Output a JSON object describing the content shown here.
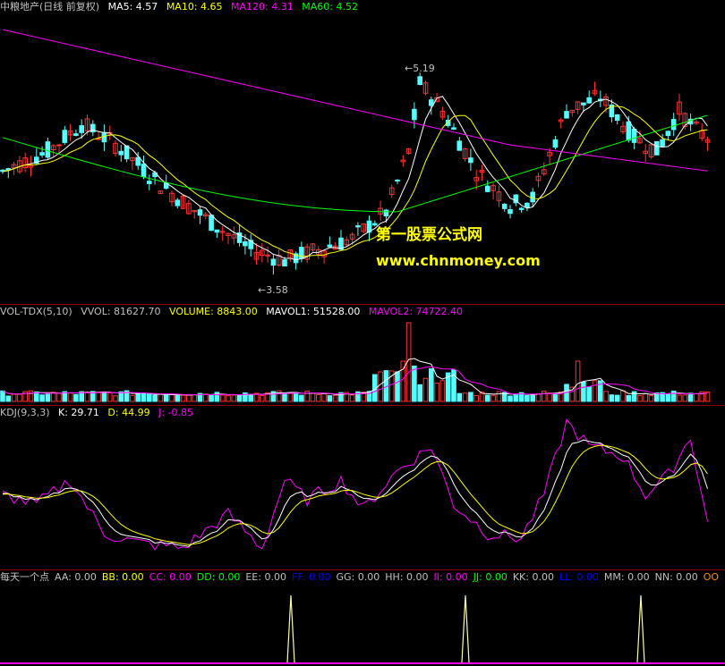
{
  "main": {
    "stock_name": "中粮地产(日线 前复权)",
    "ma_labels": [
      {
        "text": "MA5: 4.57",
        "color": "#ffffff"
      },
      {
        "text": "MA10: 4.65",
        "color": "#ffff00"
      },
      {
        "text": "MA120: 4.31",
        "color": "#ff00ff"
      },
      {
        "text": "MA60: 4.52",
        "color": "#00ff00"
      }
    ],
    "high_label": "5.19",
    "low_label": "3.58",
    "watermark_title": "第一股票公式网",
    "watermark_url": "www.chnmoney.com"
  },
  "volume": {
    "labels": [
      {
        "text": "VOL-TDX(5,10)",
        "color": "#c0c0c0"
      },
      {
        "text": "VVOL: 81627.70",
        "color": "#c0c0c0"
      },
      {
        "text": "VOLUME: 8843.00",
        "color": "#ffff00"
      },
      {
        "text": "MAVOL1: 51528.00",
        "color": "#ffffff"
      },
      {
        "text": "MAVOL2: 74722.40",
        "color": "#ff00ff"
      }
    ]
  },
  "kdj": {
    "labels": [
      {
        "text": "KDJ(9,3,3)",
        "color": "#c0c0c0"
      },
      {
        "text": "K: 29.71",
        "color": "#ffffff"
      },
      {
        "text": "D: 44.99",
        "color": "#ffff00"
      },
      {
        "text": "J: -0.85",
        "color": "#ff00ff"
      }
    ]
  },
  "signal": {
    "labels": [
      {
        "text": "每天一个点",
        "color": "#c0c0c0"
      },
      {
        "text": "AA: 0.00",
        "color": "#c0c0c0"
      },
      {
        "text": "BB: 0.00",
        "color": "#ffff00"
      },
      {
        "text": "CC: 0.00",
        "color": "#ff00ff"
      },
      {
        "text": "DD: 0.00",
        "color": "#00ff00"
      },
      {
        "text": "EE: 0.00",
        "color": "#c0c0c0"
      },
      {
        "text": "FF: 0.00",
        "color": "#0000ff"
      },
      {
        "text": "GG: 0.00",
        "color": "#c0c0c0"
      },
      {
        "text": "HH: 0.00",
        "color": "#c0c0c0"
      },
      {
        "text": "II: 0.00",
        "color": "#ff00ff"
      },
      {
        "text": "JJ: 0.00",
        "color": "#00ff00"
      },
      {
        "text": "KK: 0.00",
        "color": "#c0c0c0"
      },
      {
        "text": "LL: 0.00",
        "color": "#0000ff"
      },
      {
        "text": "MM: 0.00",
        "color": "#c0c0c0"
      },
      {
        "text": "NN: 0.00",
        "color": "#c0c0c0"
      },
      {
        "text": "OO",
        "color": "#ff8c00"
      }
    ]
  },
  "colors": {
    "up": "#ff3232",
    "down": "#54ffff",
    "ma5": "#ffffff",
    "ma10": "#ffff00",
    "ma60": "#00ff00",
    "ma120": "#ff00ff"
  }
}
